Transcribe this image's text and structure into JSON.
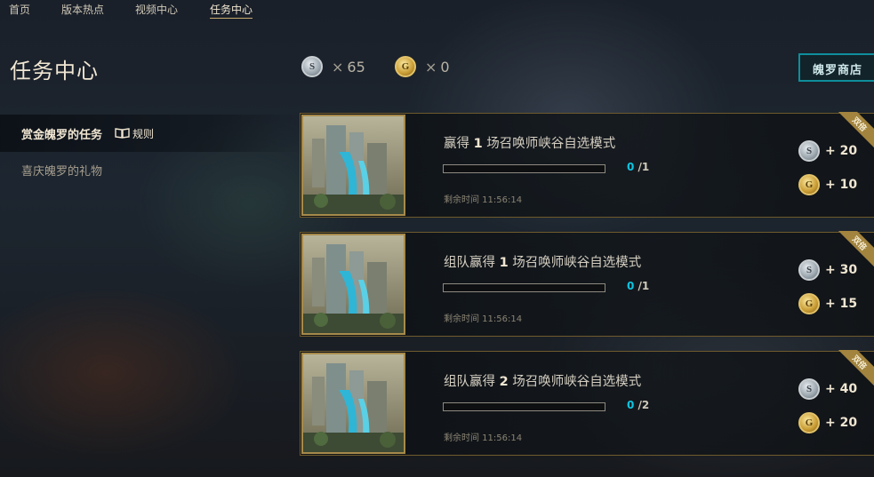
{
  "topnav": {
    "items": [
      {
        "label": "首页"
      },
      {
        "label": "版本热点"
      },
      {
        "label": "视频中心"
      },
      {
        "label": "任务中心"
      }
    ]
  },
  "page_title": "任务中心",
  "currency": {
    "silver": {
      "icon": "silver-token-icon",
      "glyph": "S",
      "count": "65",
      "times": "×"
    },
    "gold": {
      "icon": "gold-token-icon",
      "glyph": "G",
      "count": "0",
      "times": "×"
    }
  },
  "shop_button": {
    "label": "魄罗商店"
  },
  "sidebar": {
    "active": {
      "label": "赏金魄罗的任务",
      "rules_label": "规则"
    },
    "items": [
      {
        "label": "喜庆魄罗的礼物"
      }
    ]
  },
  "missions": [
    {
      "title_prefix": "赢得 ",
      "title_num": "1",
      "title_suffix": " 场召唤师峡谷自选模式",
      "progress_current": "0",
      "progress_total": "/1",
      "progress_fraction": 0,
      "timer": "剩余时间 11:56:14",
      "ribbon": "双倍",
      "rewards": [
        {
          "type": "silver",
          "glyph": "S",
          "amount": "+ 20"
        },
        {
          "type": "gold",
          "glyph": "G",
          "amount": "+ 10"
        }
      ]
    },
    {
      "title_prefix": "组队赢得 ",
      "title_num": "1",
      "title_suffix": " 场召唤师峡谷自选模式",
      "progress_current": "0",
      "progress_total": "/1",
      "progress_fraction": 0,
      "timer": "剩余时间 11:56:14",
      "ribbon": "双倍",
      "rewards": [
        {
          "type": "silver",
          "glyph": "S",
          "amount": "+ 30"
        },
        {
          "type": "gold",
          "glyph": "G",
          "amount": "+ 15"
        }
      ]
    },
    {
      "title_prefix": "组队赢得 ",
      "title_num": "2",
      "title_suffix": " 场召唤师峡谷自选模式",
      "progress_current": "0",
      "progress_total": "/2",
      "progress_fraction": 0,
      "timer": "剩余时间 11:56:14",
      "ribbon": "双倍",
      "rewards": [
        {
          "type": "silver",
          "glyph": "S",
          "amount": "+ 40"
        },
        {
          "type": "gold",
          "glyph": "G",
          "amount": "+ 20"
        }
      ]
    }
  ],
  "colors": {
    "accent_gold": "#c8aa6e",
    "accent_teal": "#0e8e9c",
    "progress_blue": "#0bc6e3"
  }
}
